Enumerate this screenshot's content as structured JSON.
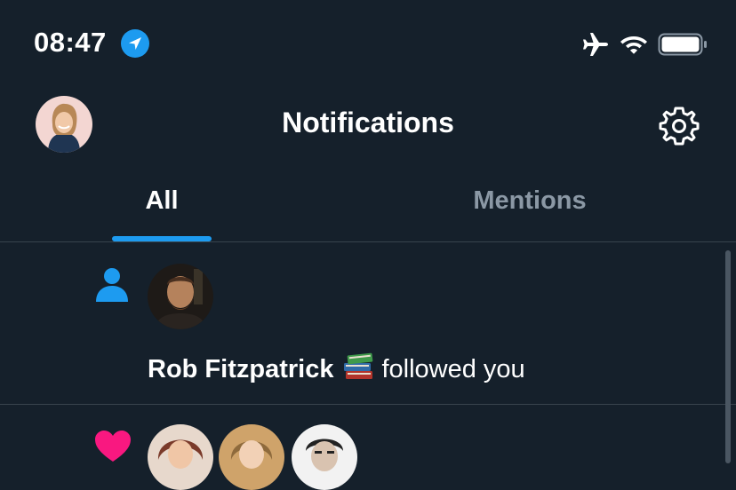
{
  "status_bar": {
    "time": "08:47",
    "icons": [
      "location-arrow-icon",
      "airplane-icon",
      "wifi-icon",
      "battery-icon"
    ]
  },
  "header": {
    "title": "Notifications",
    "settings_icon": "gear-icon"
  },
  "tabs": [
    {
      "label": "All",
      "selected": true
    },
    {
      "label": "Mentions",
      "selected": false
    }
  ],
  "notifications": [
    {
      "type": "follow",
      "icon": "person-icon",
      "user": "Rob Fitzpatrick",
      "emoji": "📚",
      "action": "followed you"
    },
    {
      "type": "like",
      "icon": "heart-icon",
      "avatars": 3
    }
  ],
  "colors": {
    "background": "#15202b",
    "accent": "#1d9bf0",
    "muted_text": "#8b98a5",
    "divider": "#38444d",
    "like": "#f91880"
  }
}
